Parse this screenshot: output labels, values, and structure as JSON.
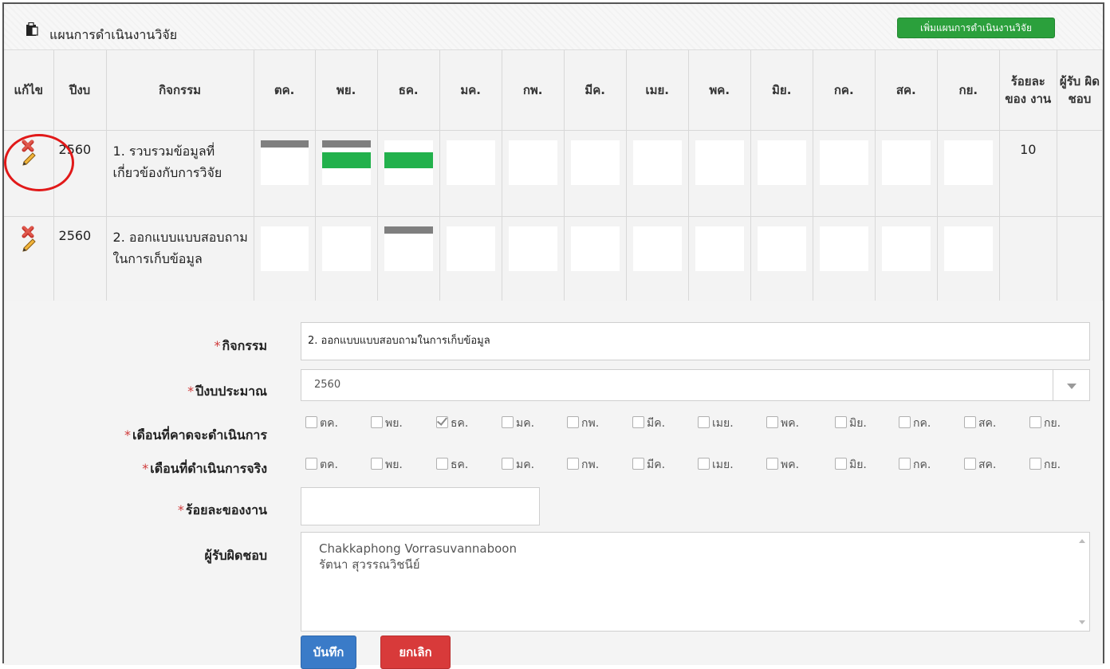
{
  "panel": {
    "title": "แผนการดำเนินงานวิจัย",
    "add_button": "เพิ่มแผนการดำเนินงานวิจัย"
  },
  "table": {
    "headers": {
      "edit": "แก้ไข",
      "year": "ปีงบ",
      "activity": "กิจกรรม",
      "months": [
        "ตค.",
        "พย.",
        "ธค.",
        "มค.",
        "กพ.",
        "มีค.",
        "เมย.",
        "พค.",
        "มิย.",
        "กค.",
        "สค.",
        "กย."
      ],
      "percent": "ร้อยละ ของ งาน",
      "responsible": "ผู้รับ ผิด ชอบ"
    },
    "rows": [
      {
        "year": "2560",
        "activity": "1. รวบรวมข้อมูลที่เกี่ยวข้องกับการวิจัย",
        "planned_months": [
          "ตค.",
          "พย."
        ],
        "actual_months": [
          "พย.",
          "ธค."
        ],
        "percent": "10",
        "responsible": ""
      },
      {
        "year": "2560",
        "activity": "2. ออกแบบแบบสอบถามในการเก็บข้อมูล",
        "planned_months": [
          "ธค."
        ],
        "actual_months": [],
        "percent": "",
        "responsible": ""
      }
    ]
  },
  "form": {
    "activity_label": "กิจกรรม",
    "activity_value": "2. ออกแบบแบบสอบถามในการเก็บข้อมูล",
    "year_label": "ปีงบประมาณ",
    "year_value": "2560",
    "planned_label": "เดือนที่คาดจะดำเนินการ",
    "actual_label": "เดือนที่ดำเนินการจริง",
    "percent_label": "ร้อยละของงาน",
    "percent_value": "",
    "responsible_label": "ผู้รับผิดชอบ",
    "responsible_people": [
      "Chakkaphong Vorrasuvannaboon",
      "รัตนา สุวรรณวิชนีย์"
    ],
    "required_mark": "*",
    "planned_checked": [
      "ธค."
    ],
    "actual_checked": [],
    "save_button": "บันทึก",
    "cancel_button": "ยกเลิก"
  },
  "colors": {
    "planned_bar": "#7f7f7f",
    "actual_bar": "#22b14c",
    "add_button": "#2ba03c",
    "save_button": "#3a7bc8",
    "cancel_button": "#d83a3a",
    "highlight_circle": "#e11919"
  },
  "icons": {
    "panel": "clipboard-icon",
    "delete": "delete-x-icon",
    "edit": "pencil-icon"
  }
}
